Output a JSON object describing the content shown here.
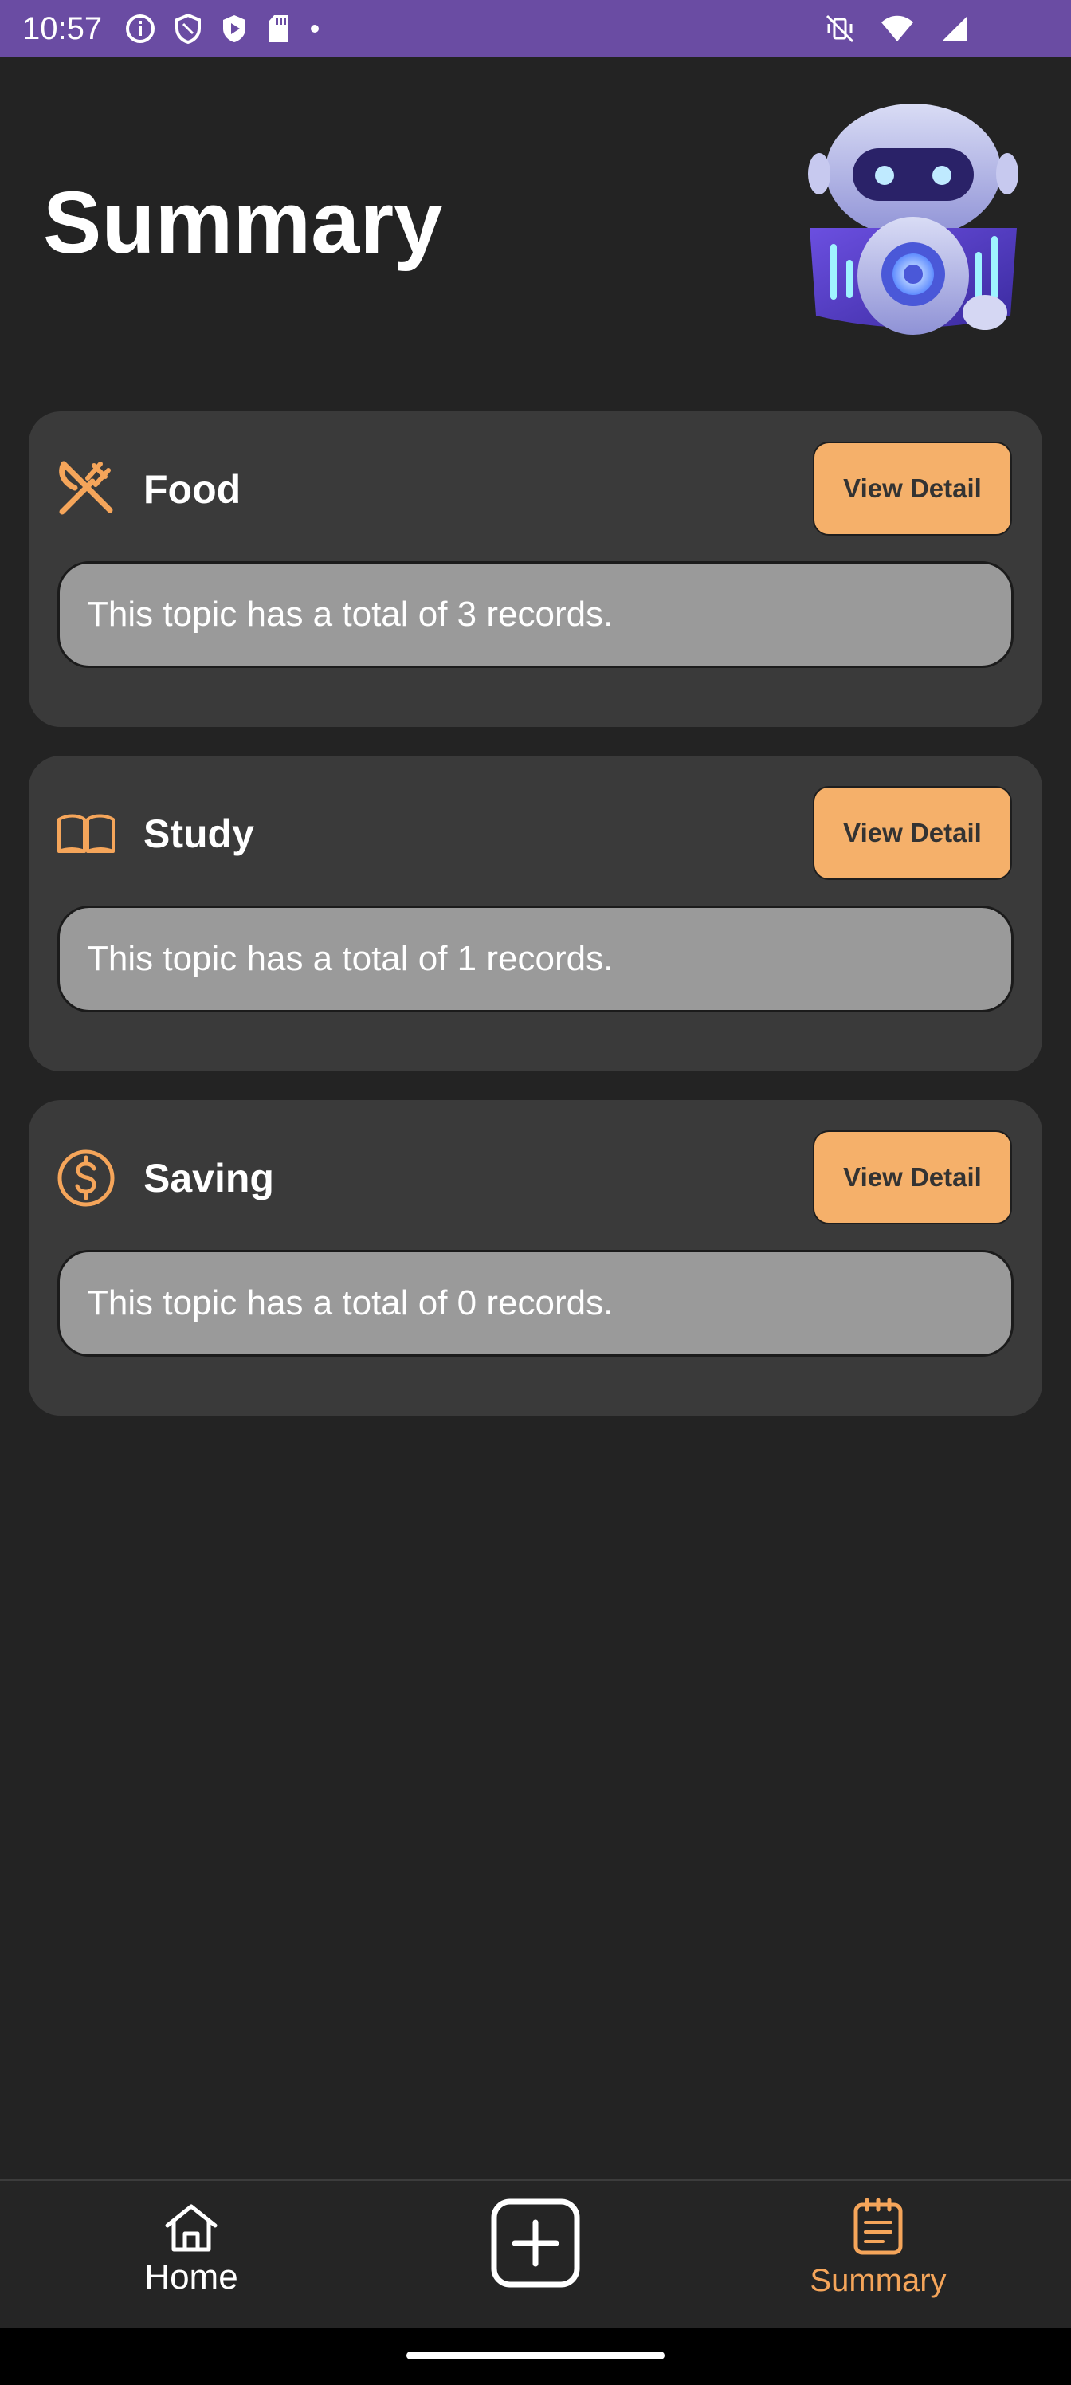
{
  "status_bar": {
    "time": "10:57",
    "left_icons": [
      "info-icon",
      "shield-icon",
      "play-shield-icon",
      "sd-card-icon",
      "dot-icon"
    ],
    "right_icons": [
      "vibrate-off-icon",
      "wifi-icon",
      "signal-icon"
    ]
  },
  "header": {
    "title": "Summary",
    "mascot": "robot-mascot"
  },
  "cards": [
    {
      "icon": "utensils-icon",
      "title": "Food",
      "button_label": "View Detail",
      "records_text": "This topic has a total of 3 records."
    },
    {
      "icon": "book-icon",
      "title": "Study",
      "button_label": "View Detail",
      "records_text": "This topic has a total of 1 records."
    },
    {
      "icon": "dollar-circle-icon",
      "title": "Saving",
      "button_label": "View Detail",
      "records_text": "This topic has a total of 0 records."
    }
  ],
  "bottom_nav": {
    "home_label": "Home",
    "add_icon": "plus-square-icon",
    "summary_label": "Summary",
    "active": "Summary"
  },
  "colors": {
    "accent": "#f5b06a",
    "status_bar": "#6a4ca3",
    "background": "#232323",
    "card": "#3a3a3a",
    "record_box": "#9a9a9a"
  }
}
